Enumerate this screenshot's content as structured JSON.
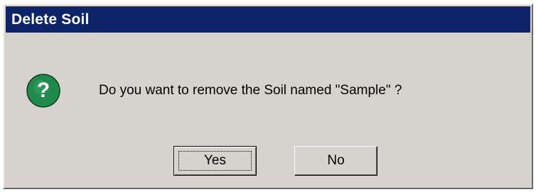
{
  "dialog": {
    "title": "Delete Soil",
    "message": "Do you want to remove the Soil named \"Sample\" ?",
    "icon": "question-icon",
    "colors": {
      "titlebar": "#0d2468",
      "dialog_bg": "#d6d3ce",
      "icon_green": "#1f8a4c"
    },
    "buttons": {
      "yes_label": "Yes",
      "no_label": "No"
    }
  }
}
